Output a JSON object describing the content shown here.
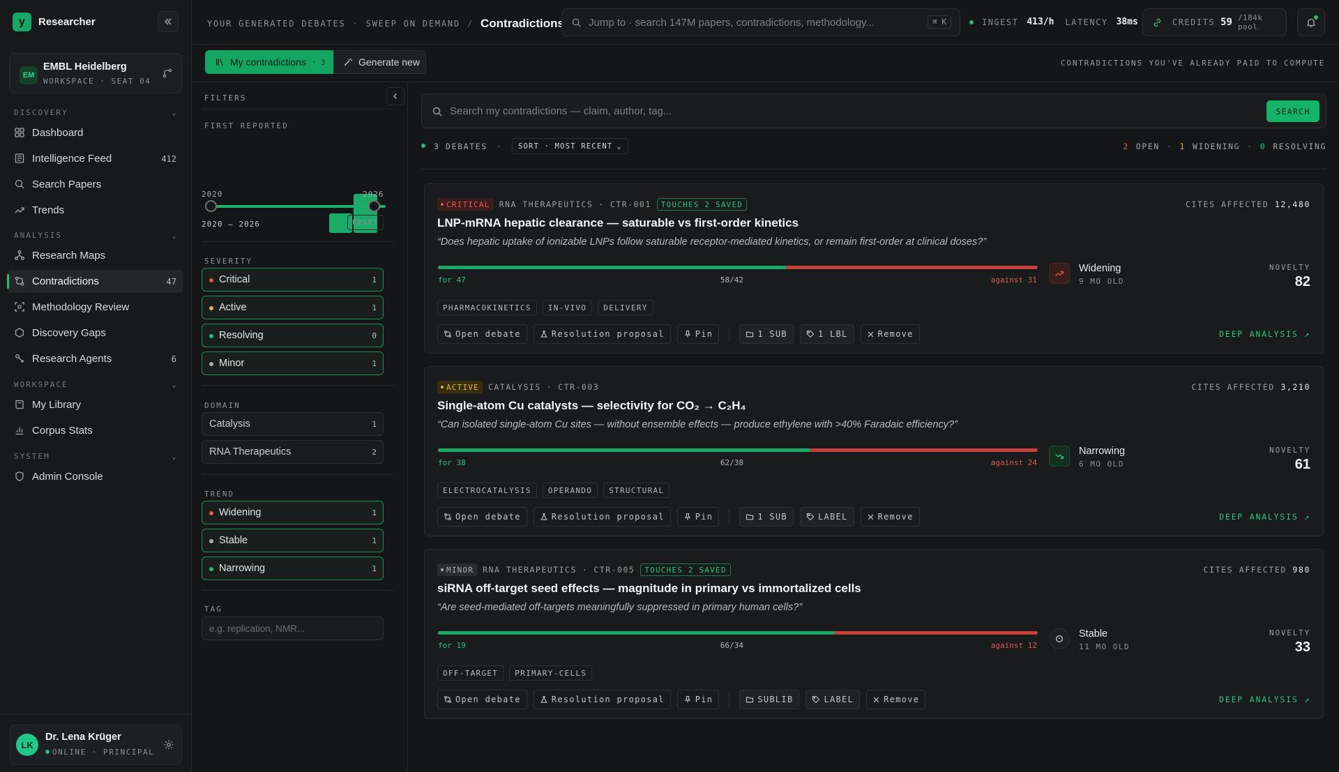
{
  "brand": {
    "logo": "y",
    "name": "Researcher"
  },
  "workspace": {
    "initials": "EM",
    "name": "EMBL Heidelberg",
    "sub": "WORKSPACE · SEAT 04"
  },
  "nav": {
    "discovery": "DISCOVERY",
    "analysis": "ANALYSIS",
    "workspace": "WORKSPACE",
    "system": "SYSTEM",
    "dashboard": "Dashboard",
    "feed": "Intelligence Feed",
    "feed_count": "412",
    "search": "Search Papers",
    "trends": "Trends",
    "maps": "Research Maps",
    "contradictions": "Contradictions",
    "contradictions_count": "47",
    "methodology": "Methodology Review",
    "gaps": "Discovery Gaps",
    "agents": "Research Agents",
    "agents_count": "6",
    "library": "My Library",
    "corpus": "Corpus Stats",
    "admin": "Admin Console"
  },
  "user": {
    "initials": "LK",
    "name": "Dr. Lena Krüger",
    "status": "ONLINE · PRINCIPAL"
  },
  "topbar": {
    "crumb1": "YOUR GENERATED DEBATES",
    "crumb2": "SWEEP ON DEMAND",
    "current": "Contradictions",
    "jump_placeholder": "Jump to · search 147M papers, contradictions, methodology...",
    "kbd": "⌘ K",
    "ingest_label": "INGEST",
    "ingest_value": "413/h",
    "latency_label": "LATENCY",
    "latency_value": "38ms",
    "credits_label": "CREDITS",
    "credits_value": "59",
    "credits_pool": "/184k pool"
  },
  "tabs": {
    "mine": "My contradictions",
    "mine_count": "· 3",
    "generate": "Generate new",
    "note": "CONTRADICTIONS YOU'VE ALREADY PAID TO COMPUTE"
  },
  "filters": {
    "title": "FILTERS",
    "first_reported": "FIRST REPORTED",
    "year_start": "2020",
    "year_end": "2026",
    "range_text": "2020 – 2026",
    "reset": "RESET",
    "histogram": [
      0,
      0,
      0,
      0,
      0,
      1,
      2
    ],
    "severity_label": "SEVERITY",
    "severity": [
      {
        "label": "Critical",
        "count": "1",
        "color": "#e0584d"
      },
      {
        "label": "Active",
        "count": "1",
        "color": "#e9b33a"
      },
      {
        "label": "Resolving",
        "count": "0",
        "color": "#22c074"
      },
      {
        "label": "Minor",
        "count": "1",
        "color": "#a9aeac"
      }
    ],
    "domain_label": "DOMAIN",
    "domain": [
      {
        "label": "Catalysis",
        "count": "1"
      },
      {
        "label": "RNA Therapeutics",
        "count": "2"
      }
    ],
    "trend_label": "TREND",
    "trend": [
      {
        "label": "Widening",
        "count": "1",
        "color": "#e0584d"
      },
      {
        "label": "Stable",
        "count": "1",
        "color": "#a9aeac"
      },
      {
        "label": "Narrowing",
        "count": "1",
        "color": "#22c074"
      }
    ],
    "tag_label": "TAG",
    "tag_placeholder": "e.g. replication, NMR..."
  },
  "main": {
    "search_placeholder": "Search my contradictions — claim, author, tag...",
    "search_button": "SEARCH",
    "count": "3 DEBATES",
    "sort": "SORT · MOST RECENT",
    "open_n": "2",
    "open_l": "OPEN",
    "widen_n": "1",
    "widen_l": "WIDENING",
    "resolving_n": "0",
    "resolving_l": "RESOLVING"
  },
  "cards": [
    {
      "severity": "CRITICAL",
      "domain": "RNA THERAPEUTICS",
      "id": "CTR-001",
      "touches": "TOUCHES 2 SAVED",
      "cites_label": "CITES AFFECTED",
      "cites": "12,480",
      "title": "LNP-mRNA hepatic clearance — saturable vs first-order kinetics",
      "quote": "“Does hepatic uptake of ionizable LNPs follow saturable receptor-mediated kinetics, or remain first-order at clinical doses?”",
      "for_pct": 58,
      "for": "for 47",
      "ratio": "58/42",
      "against": "against 31",
      "trend": "Widening",
      "age": "9 MO OLD",
      "novelty_label": "NOVELTY",
      "novelty": "82",
      "tags": [
        "PHARMACOKINETICS",
        "IN-VIVO",
        "DELIVERY"
      ],
      "a_open": "Open debate",
      "a_res": "Resolution proposal",
      "a_pin": "Pin",
      "a_sub": "1 SUB",
      "a_lbl": "1 LBL",
      "a_rm": "Remove",
      "deep": "DEEP ANALYSIS ↗"
    },
    {
      "severity": "ACTIVE",
      "domain": "CATALYSIS",
      "id": "CTR-003",
      "touches": "",
      "cites_label": "CITES AFFECTED",
      "cites": "3,210",
      "title": "Single-atom Cu catalysts — selectivity for CO₂ → C₂H₄",
      "quote": "“Can isolated single-atom Cu sites — without ensemble effects — produce ethylene with >40% Faradaic efficiency?”",
      "for_pct": 62,
      "for": "for 38",
      "ratio": "62/38",
      "against": "against 24",
      "trend": "Narrowing",
      "age": "6 MO OLD",
      "novelty_label": "NOVELTY",
      "novelty": "61",
      "tags": [
        "ELECTROCATALYSIS",
        "OPERANDO",
        "STRUCTURAL"
      ],
      "a_open": "Open debate",
      "a_res": "Resolution proposal",
      "a_pin": "Pin",
      "a_sub": "1 SUB",
      "a_lbl": "LABEL",
      "a_rm": "Remove",
      "deep": "DEEP ANALYSIS ↗"
    },
    {
      "severity": "MINOR",
      "domain": "RNA THERAPEUTICS",
      "id": "CTR-005",
      "touches": "TOUCHES 2 SAVED",
      "cites_label": "CITES AFFECTED",
      "cites": "980",
      "title": "siRNA off-target seed effects — magnitude in primary vs immortalized cells",
      "quote": "“Are seed-mediated off-targets meaningfully suppressed in primary human cells?”",
      "for_pct": 66,
      "for": "for 19",
      "ratio": "66/34",
      "against": "against 12",
      "trend": "Stable",
      "age": "11 MO OLD",
      "novelty_label": "NOVELTY",
      "novelty": "33",
      "tags": [
        "OFF-TARGET",
        "PRIMARY-CELLS"
      ],
      "a_open": "Open debate",
      "a_res": "Resolution proposal",
      "a_pin": "Pin",
      "a_sub": "SUBLIB",
      "a_lbl": "LABEL",
      "a_rm": "Remove",
      "deep": "DEEP ANALYSIS ↗"
    }
  ]
}
